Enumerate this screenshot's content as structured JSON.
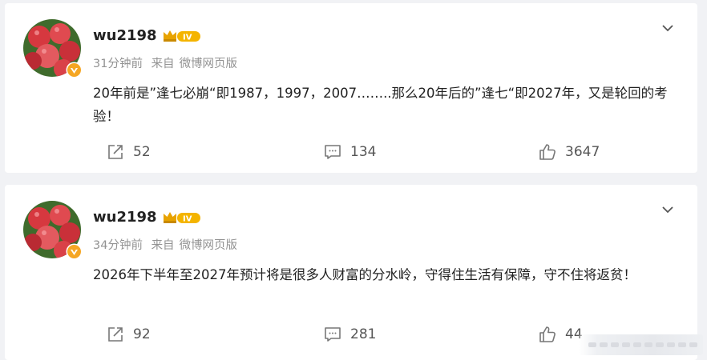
{
  "posts": [
    {
      "username": "wu2198",
      "level": "IV",
      "time": "31分钟前",
      "source_prefix": "来自",
      "source": "微博网页版",
      "content": "20年前是”逢七必崩“即1987，1997，2007……..那么20年后的”逢七“即2027年，又是轮回的考验！",
      "reposts": "52",
      "comments": "134",
      "likes": "3647"
    },
    {
      "username": "wu2198",
      "level": "IV",
      "time": "34分钟前",
      "source_prefix": "来自",
      "source": "微博网页版",
      "content": "2026年下半年至2027年预计将是很多人财富的分水岭，守得住生活有保障，守不住将返贫！",
      "reposts": "92",
      "comments": "281",
      "likes": "44"
    }
  ],
  "icons": {
    "repost": "repost-icon",
    "comment": "comment-icon",
    "like": "like-icon",
    "more": "chevron-down-icon",
    "verified": "verified-badge-icon",
    "level": "crown-level-icon"
  },
  "colors": {
    "verified": "#f5a623",
    "level_gold": "#e8a300",
    "meta": "#939393"
  }
}
